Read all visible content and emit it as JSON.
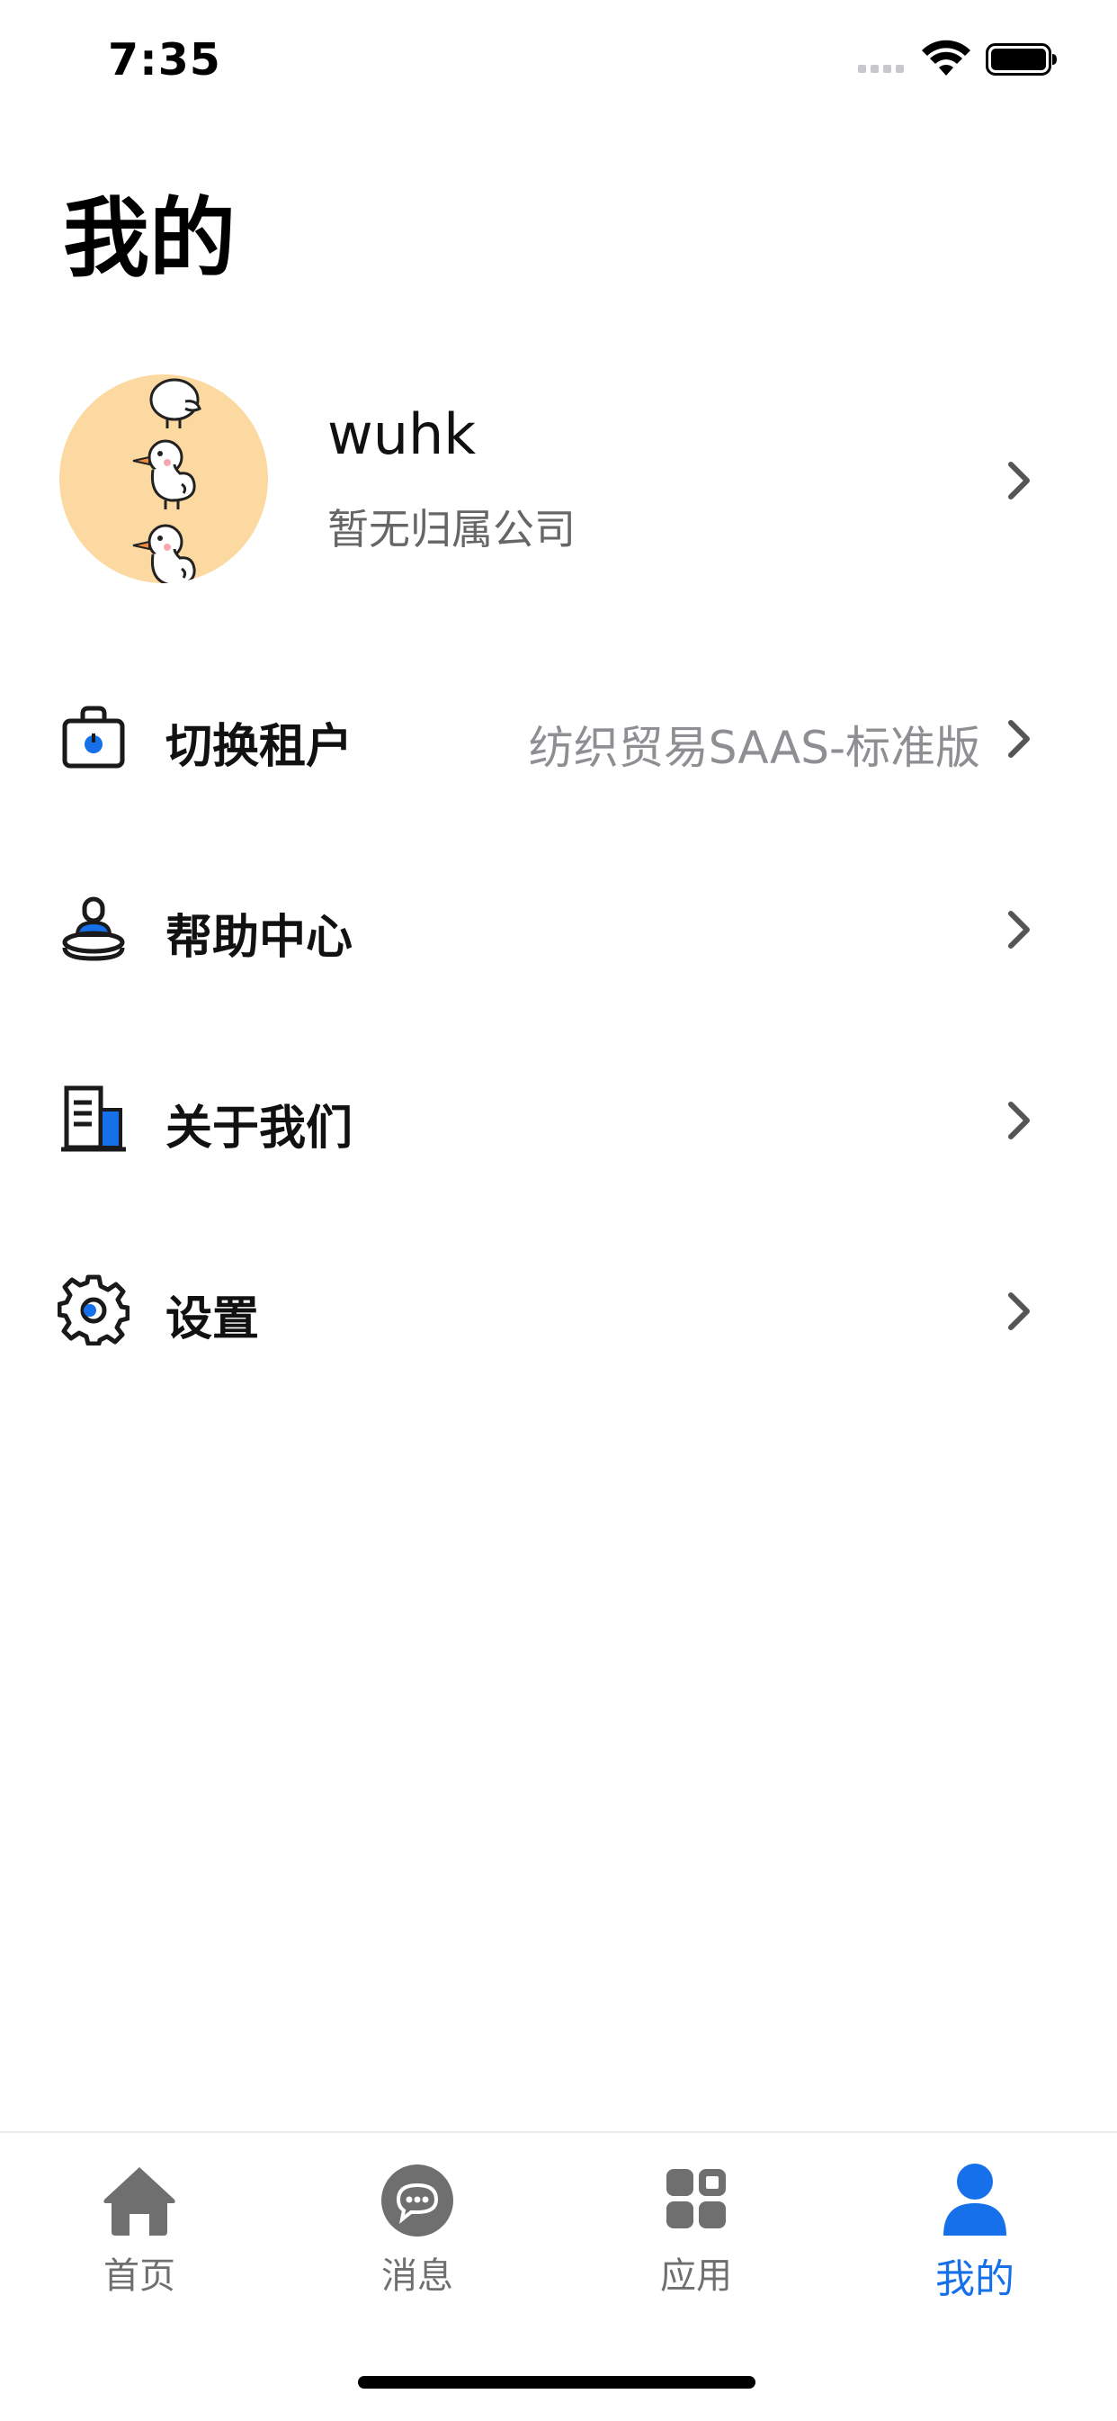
{
  "status_bar": {
    "time": "7:35"
  },
  "page": {
    "title": "我的"
  },
  "profile": {
    "name": "wuhk",
    "company": "暂无归属公司"
  },
  "menu": {
    "items": [
      {
        "label": "切换租户",
        "value": "纺织贸易SAAS-标准版",
        "icon": "tenant-switch-icon"
      },
      {
        "label": "帮助中心",
        "value": "",
        "icon": "help-center-icon"
      },
      {
        "label": "关于我们",
        "value": "",
        "icon": "about-us-icon"
      },
      {
        "label": "设置",
        "value": "",
        "icon": "settings-gear-icon"
      }
    ]
  },
  "tabbar": {
    "tabs": [
      {
        "label": "首页",
        "icon": "home-icon",
        "active": false
      },
      {
        "label": "消息",
        "icon": "message-icon",
        "active": false
      },
      {
        "label": "应用",
        "icon": "apps-grid-icon",
        "active": false
      },
      {
        "label": "我的",
        "icon": "profile-icon",
        "active": true
      }
    ]
  },
  "colors": {
    "accent": "#1570e9",
    "tab_inactive": "#6f6f6f",
    "avatar_bg": "#fdd9a2",
    "secondary_text": "#8e8e93"
  }
}
